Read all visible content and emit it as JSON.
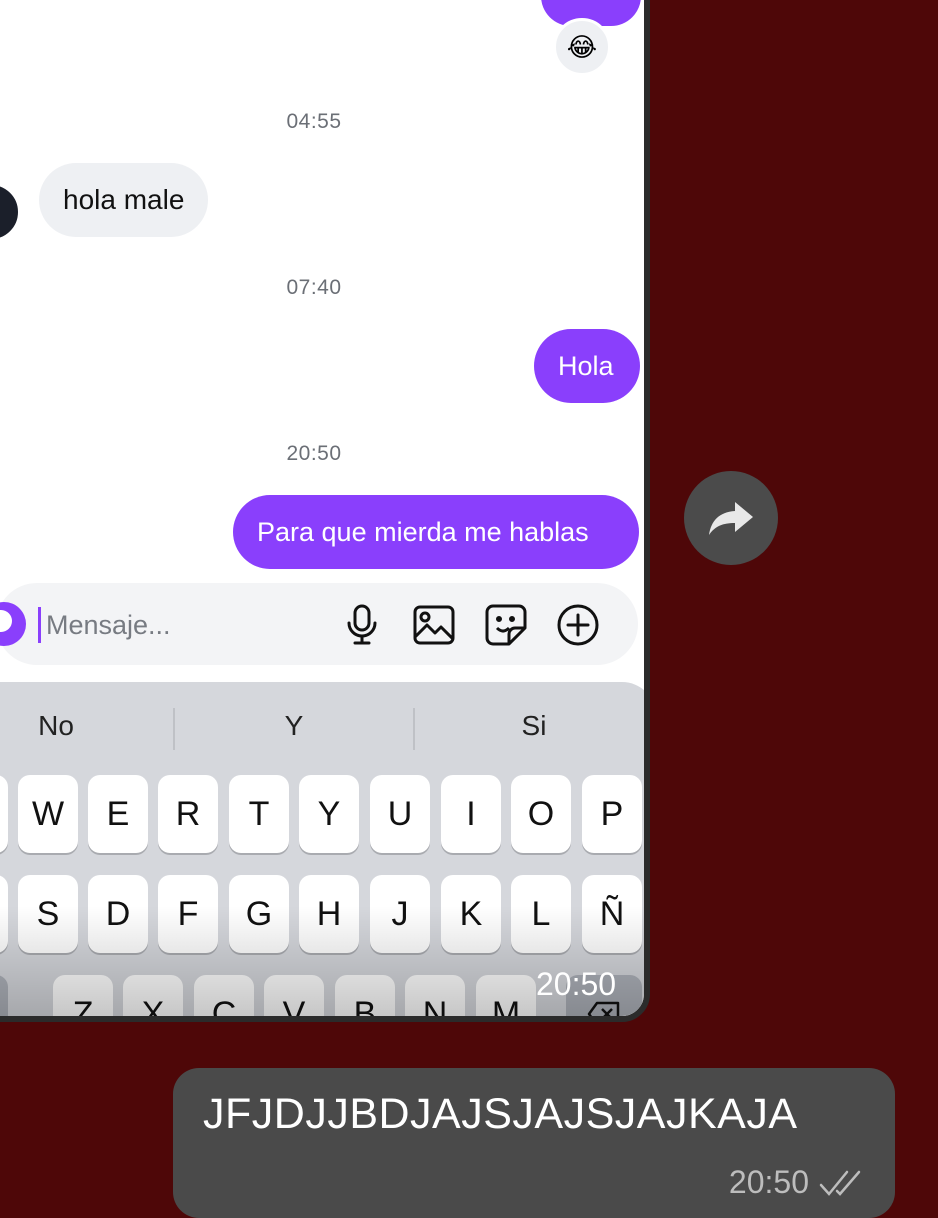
{
  "embedded_chat": {
    "reaction_emoji": "😂",
    "timestamps": [
      "04:55",
      "07:40",
      "20:50"
    ],
    "incoming_message": "hola male",
    "outgoing_messages": [
      "Hola",
      "Para que mierda me hablas"
    ],
    "composer_placeholder": "Mensaje...",
    "composer_icons": [
      "microphone-icon",
      "image-icon",
      "sticker-icon",
      "plus-icon"
    ],
    "accent_color": "#8a3ffc",
    "keyboard": {
      "suggestions": [
        "No",
        "Y",
        "Si"
      ],
      "row1": [
        "W",
        "E",
        "R",
        "T",
        "Y",
        "U",
        "I",
        "O",
        "P"
      ],
      "row2": [
        "S",
        "D",
        "F",
        "G",
        "H",
        "J",
        "K",
        "L",
        "Ñ"
      ],
      "row3": [
        "Z",
        "X",
        "C",
        "V",
        "B",
        "N",
        "M"
      ]
    },
    "screenshot_time": "20:50"
  },
  "forward_button": {
    "icon": "forward-arrow-icon"
  },
  "outgoing_message": {
    "text": "JFJDJJBDJAJSJAJSJAJKAJA",
    "time": "20:50",
    "status_icon": "double-check-icon"
  },
  "colors": {
    "background": "#4e0708",
    "bubble": "#4a4a4a"
  }
}
